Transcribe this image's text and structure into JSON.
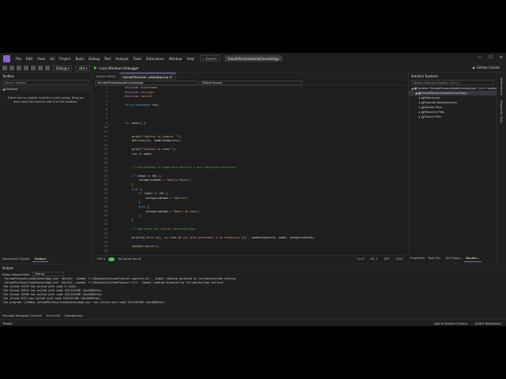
{
  "titlebar": {
    "menu": [
      "File",
      "Edit",
      "View",
      "Git",
      "Project",
      "Build",
      "Debug",
      "Test",
      "Analyze",
      "Tools",
      "Extensions",
      "Window",
      "Help"
    ],
    "search": "Search",
    "solution_name": "SaludoPersonalizadoConsoleApp",
    "minimize": "—",
    "maximize": "☐",
    "close": "✕"
  },
  "toolbar": {
    "config": "Debug",
    "platform": "x64",
    "run_label": "Local Windows Debugger",
    "copilot": "GitHub Copilot"
  },
  "toolbox": {
    "title": "Toolbox",
    "search_placeholder": "Search Toolbox",
    "group": "General",
    "message": "There are no usable controls in this group. Drag an item onto this text to add it to the toolbox.",
    "tabs": [
      "Document Outline",
      "Toolbox"
    ]
  },
  "editor": {
    "tabs": [
      "What's New?",
      "SaludoPersonal...aodoApp.cpp"
    ],
    "project_dropdown": "SaludoPersonalizadoConsoleApp",
    "scope_dropdown": "(Global Scope)",
    "lines": [
      {
        "n": "1",
        "t": "#include <iostream>"
      },
      {
        "n": "2",
        "t": "#include <string>"
      },
      {
        "n": "3",
        "t": "#include <print>"
      },
      {
        "n": "4",
        "t": ""
      },
      {
        "n": "5",
        "t": "using namespace std;"
      },
      {
        "n": "6",
        "t": ""
      },
      {
        "n": "7",
        "t": ""
      },
      {
        "n": "8",
        "t": ""
      },
      {
        "n": "9",
        "t": "int main() {"
      },
      {
        "n": "10",
        "t": ""
      },
      {
        "n": "11",
        "t": ""
      },
      {
        "n": "12",
        "t": "    print(\"Ingrese su nombre: \");"
      },
      {
        "n": "13",
        "t": "    getline(cin, nombreCompleto);"
      },
      {
        "n": "14",
        "t": ""
      },
      {
        "n": "15",
        "t": "    print(\"Ingrese su edad:\");"
      },
      {
        "n": "16",
        "t": "    cin >> edad;"
      },
      {
        "n": "17",
        "t": ""
      },
      {
        "n": "18",
        "t": ""
      },
      {
        "n": "19",
        "t": "    // validaremos la edad para definir a que categoria pertenece"
      },
      {
        "n": "20",
        "t": ""
      },
      {
        "n": "21",
        "t": "    if (edad >= 66) {"
      },
      {
        "n": "22",
        "t": "        categoriaEdad = \"Adulto Mayor\";"
      },
      {
        "n": "23",
        "t": "    }"
      },
      {
        "n": "24",
        "t": "    else {"
      },
      {
        "n": "25",
        "t": "        if (edad >= 18) {"
      },
      {
        "n": "26",
        "t": "            categoriaEdad = \"Adulto\";"
      },
      {
        "n": "27",
        "t": "        }"
      },
      {
        "n": "28",
        "t": "        else {"
      },
      {
        "n": "29",
        "t": "            categoriaEdad = \"Menor de Edad\";"
      },
      {
        "n": "30",
        "t": "        }"
      },
      {
        "n": "31",
        "t": "    }"
      },
      {
        "n": "32",
        "t": ""
      },
      {
        "n": "33",
        "t": "    // impresión del saludo personalizado"
      },
      {
        "n": "34",
        "t": ""
      },
      {
        "n": "35",
        "t": "    println(\"Hola {0}, su edad de {1} años pertenece a la categoria {2}\", nombreCompleto, edad, categoriaEdad);"
      },
      {
        "n": "36",
        "t": ""
      },
      {
        "n": "37",
        "t": "    system(\"pause\");"
      },
      {
        "n": "38",
        "t": ""
      }
    ],
    "status": {
      "zoom": "100 %",
      "issues": "No issues found",
      "position": "Ln: 8",
      "col": "Ch: 1",
      "spc": "SPC",
      "crlf": "CRLF"
    }
  },
  "solution_explorer": {
    "title": "Solution Explorer",
    "search_placeholder": "Search Solution Explorer (Ctrl+;)",
    "items": [
      {
        "label": "Solution 'SaludoPersonalizadoConsoleApp' (1 of 1 project)",
        "indent": 0
      },
      {
        "label": "SaludoPersonalizadoConsoleApp",
        "indent": 1,
        "selected": true
      },
      {
        "label": "References",
        "indent": 2
      },
      {
        "label": "External Dependencies",
        "indent": 2
      },
      {
        "label": "Header Files",
        "indent": 2
      },
      {
        "label": "Resource Files",
        "indent": 2
      },
      {
        "label": "Source Files",
        "indent": 2
      }
    ],
    "tabs": [
      "Properties",
      "Team Ex...",
      "Git Chang...",
      "Solution..."
    ],
    "side_labels": [
      "Notifications",
      "Diagnostic Tools"
    ]
  },
  "output": {
    "title": "Output",
    "show_from_label": "Show output from:",
    "show_from_value": "Debug",
    "lines": [
      "'SaludoPersonalizadoConsoleApp.exe' (Win32): Loaded 'C:\\Windows\\System32\\kernel.appcore.dll'. Symbol loading disabled by Include/Exclude setting.",
      "'SaludoPersonalizadoConsoleApp.exe' (Win32): Loaded 'C:\\Windows\\System32\\msvcrt.dll'. Symbol loading disabled by Include/Exclude setting.",
      "The thread 27976 has exited with code 0 (0x0).",
      "The thread 33924 has exited with code 3221225786 (0xc000013a).",
      "The thread 24980 has exited with code 3221225786 (0xc000013a).",
      "The thread 8724 has exited with code 3221225786 (0xc000013a).",
      "The program '[19064] SaludoPersonalizadoConsoleApp.exe' has exited with code 3221225786 (0xc000013a)."
    ]
  },
  "bottom_tabs": [
    "Package Manager Console",
    "Error List",
    "Breakpoints"
  ],
  "statusbar": {
    "ready": "Ready",
    "add_source": "Add to Source Control",
    "select_repo": "Select Repository"
  }
}
